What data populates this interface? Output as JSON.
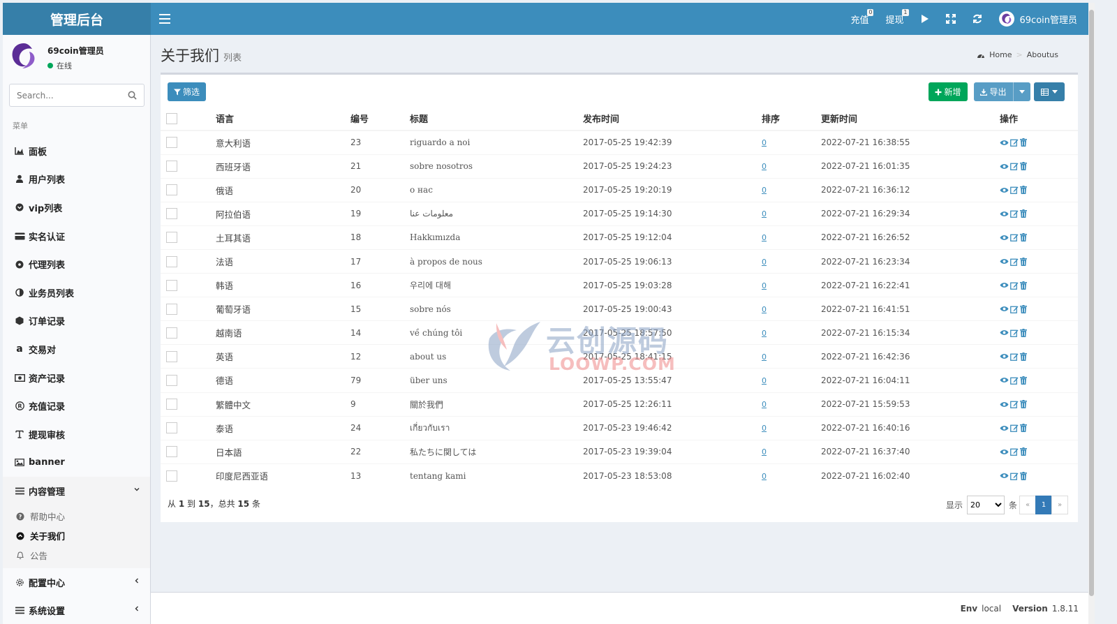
{
  "brand": "管理后台",
  "navbar": {
    "recharge": {
      "label": "充值",
      "badge": "0"
    },
    "withdraw": {
      "label": "提现",
      "badge": "1"
    },
    "admin_name": "69coin管理员"
  },
  "user": {
    "name": "69coin管理员",
    "status": "在线"
  },
  "search": {
    "placeholder": "Search..."
  },
  "menu_header": "菜单",
  "menu": [
    {
      "label": "面板",
      "icon": "area-chart-icon"
    },
    {
      "label": "用户列表",
      "icon": "user-icon"
    },
    {
      "label": "vip列表",
      "icon": "chevron-circle-icon"
    },
    {
      "label": "实名认证",
      "icon": "credit-card-icon"
    },
    {
      "label": "代理列表",
      "icon": "circle-icon"
    },
    {
      "label": "业务员列表",
      "icon": "half-circle-icon"
    },
    {
      "label": "订单记录",
      "icon": "hexagon-icon"
    },
    {
      "label": "交易对",
      "icon": "amazon-a-icon"
    },
    {
      "label": "资产记录",
      "icon": "money-icon"
    },
    {
      "label": "充值记录",
      "icon": "registered-icon"
    },
    {
      "label": "提现审核",
      "icon": "text-icon"
    },
    {
      "label": "banner",
      "icon": "image-icon"
    }
  ],
  "content_menu": {
    "label": "内容管理",
    "items": [
      {
        "label": "帮助中心",
        "icon": "question-circle-icon"
      },
      {
        "label": "关于我们",
        "icon": "chevron-circle-up-icon"
      },
      {
        "label": "公告",
        "icon": "bell-icon"
      }
    ]
  },
  "config_menu": {
    "label": "配置中心"
  },
  "system_menu": {
    "label": "系统设置"
  },
  "page": {
    "title": "关于我们",
    "subtitle": "列表"
  },
  "breadcrumb": {
    "home": "Home",
    "current": "Aboutus"
  },
  "toolbar": {
    "filter": "筛选",
    "add": "新增",
    "export": "导出"
  },
  "table": {
    "headers": [
      "语言",
      "编号",
      "标题",
      "发布时间",
      "排序",
      "更新时间",
      "操作"
    ],
    "rows": [
      {
        "lang": "意大利语",
        "id": "23",
        "title": "riguardo a noi",
        "published": "2017-05-25 19:42:39",
        "sort": "0",
        "updated": "2022-07-21 16:38:55"
      },
      {
        "lang": "西班牙语",
        "id": "21",
        "title": "sobre nosotros",
        "published": "2017-05-25 19:24:23",
        "sort": "0",
        "updated": "2022-07-21 16:01:35"
      },
      {
        "lang": "俄语",
        "id": "20",
        "title": "о нас",
        "published": "2017-05-25 19:20:19",
        "sort": "0",
        "updated": "2022-07-21 16:36:12"
      },
      {
        "lang": "阿拉伯语",
        "id": "19",
        "title": "معلومات عنا",
        "published": "2017-05-25 19:14:30",
        "sort": "0",
        "updated": "2022-07-21 16:29:34"
      },
      {
        "lang": "土耳其语",
        "id": "18",
        "title": "Hakkımızda",
        "published": "2017-05-25 19:12:04",
        "sort": "0",
        "updated": "2022-07-21 16:26:52"
      },
      {
        "lang": "法语",
        "id": "17",
        "title": "à propos de nous",
        "published": "2017-05-25 19:06:13",
        "sort": "0",
        "updated": "2022-07-21 16:23:34"
      },
      {
        "lang": "韩语",
        "id": "16",
        "title": "우리에 대해",
        "published": "2017-05-25 19:03:28",
        "sort": "0",
        "updated": "2022-07-21 16:22:41"
      },
      {
        "lang": "葡萄牙语",
        "id": "15",
        "title": "sobre nós",
        "published": "2017-05-25 19:00:43",
        "sort": "0",
        "updated": "2022-07-21 16:41:51"
      },
      {
        "lang": "越南语",
        "id": "14",
        "title": "về chúng tôi",
        "published": "2017-05-25 18:57:50",
        "sort": "0",
        "updated": "2022-07-21 16:15:34"
      },
      {
        "lang": "英语",
        "id": "12",
        "title": "about us",
        "published": "2017-05-25 18:41:15",
        "sort": "0",
        "updated": "2022-07-21 16:42:36"
      },
      {
        "lang": "德语",
        "id": "79",
        "title": "über uns",
        "published": "2017-05-25 13:55:47",
        "sort": "0",
        "updated": "2022-07-21 16:04:11"
      },
      {
        "lang": "繁體中文",
        "id": "9",
        "title": "關於我們",
        "published": "2017-05-25 12:26:11",
        "sort": "0",
        "updated": "2022-07-21 15:59:53"
      },
      {
        "lang": "泰语",
        "id": "24",
        "title": "เกี่ยวกับเรา",
        "published": "2017-05-23 19:46:42",
        "sort": "0",
        "updated": "2022-07-21 16:40:16"
      },
      {
        "lang": "日本語",
        "id": "22",
        "title": "私たちに関しては",
        "published": "2017-05-23 19:39:04",
        "sort": "0",
        "updated": "2022-07-21 16:37:40"
      },
      {
        "lang": "印度尼西亚语",
        "id": "13",
        "title": "tentang kami",
        "published": "2017-05-23 18:53:08",
        "sort": "0",
        "updated": "2022-07-21 16:02:40"
      }
    ]
  },
  "pager": {
    "prefix": "从",
    "from": "1",
    "to_word": "到",
    "to": "15",
    "total_word": "，总共",
    "total": "15",
    "suffix": "条",
    "show_label": "显示",
    "page_size": "20",
    "unit": "条",
    "prev": "«",
    "current": "1",
    "next": "»"
  },
  "footer": {
    "env_label": "Env",
    "env": "local",
    "version_label": "Version",
    "version": "1.8.11"
  },
  "watermark": {
    "cn": "云创源码",
    "en": "LOOWP.COM"
  },
  "colors": {
    "primary": "#3c8dbc",
    "success": "#00a65a",
    "brand_dark": "#367fa9"
  }
}
